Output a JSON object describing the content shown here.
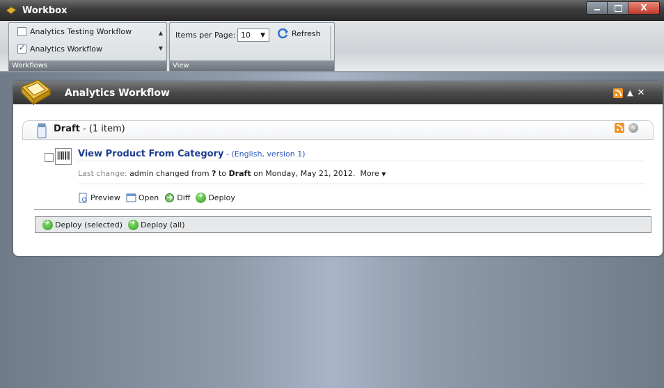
{
  "window": {
    "title": "Workbox",
    "close_label": "X"
  },
  "ribbon": {
    "workflows": {
      "label": "Workflows",
      "items": [
        {
          "label": "Analytics Testing Workflow",
          "checked": false
        },
        {
          "label": "Analytics Workflow",
          "checked": true
        }
      ]
    },
    "view": {
      "label": "View",
      "items_per_page_label": "Items per Page:",
      "items_per_page_value": "10",
      "refresh_label": "Refresh"
    }
  },
  "panel": {
    "title": "Analytics Workflow",
    "draft": {
      "state": "Draft",
      "count_text": " - (1 item)"
    },
    "item": {
      "title": "View Product From Category",
      "meta": " - (English, version 1)",
      "last_change_label": "Last change:",
      "change_user": " admin changed from ",
      "from_state": "?",
      "to_word": " to ",
      "to_state": "Draft",
      "date_text": " on Monday, May 21, 2012.",
      "more_label": "More",
      "actions": [
        "Preview",
        "Open",
        "Diff",
        "Deploy"
      ]
    },
    "deploy_selected": "Deploy (selected)",
    "deploy_all": "Deploy (all)"
  },
  "colors": {
    "link_blue": "#1e3d8f",
    "rss_orange": "#f39325",
    "deploy_green": "#2e9a1a"
  }
}
